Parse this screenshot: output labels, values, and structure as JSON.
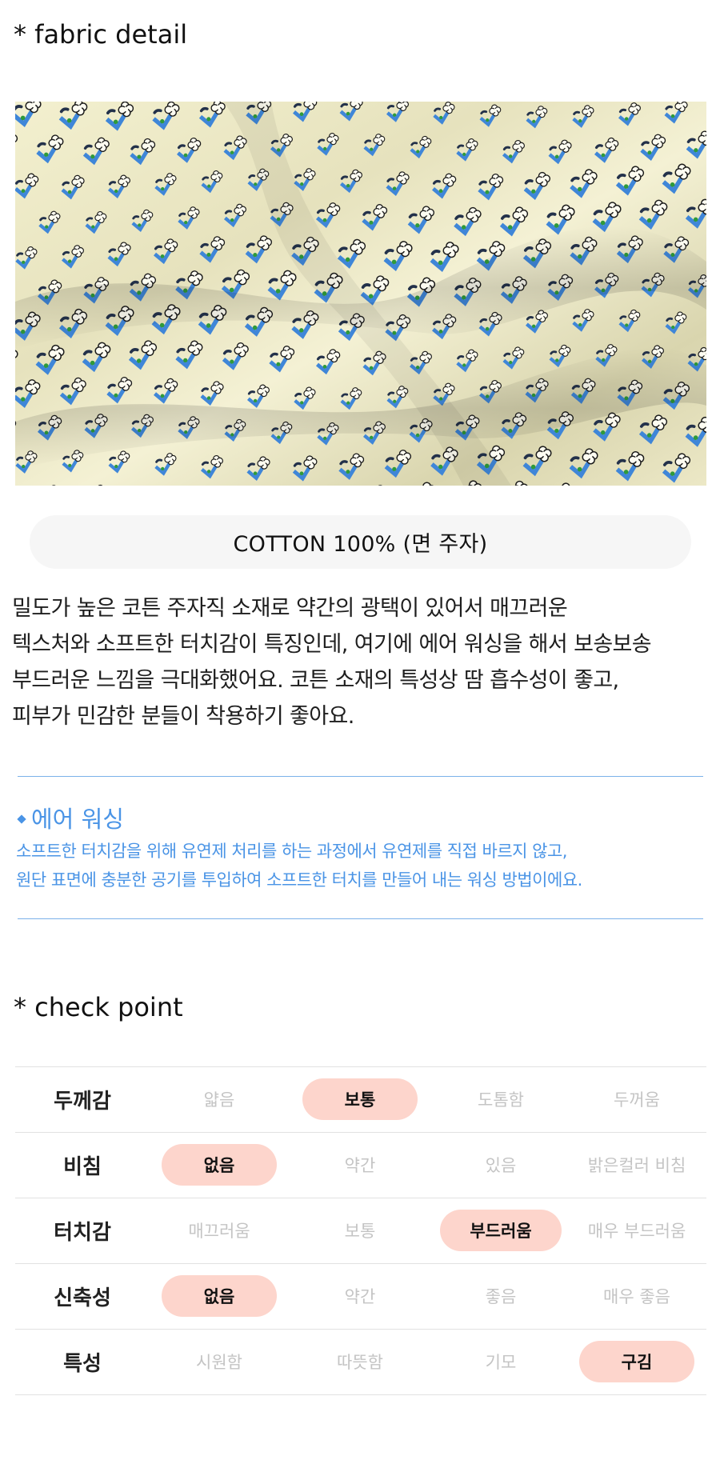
{
  "fabric_detail": {
    "title": "* fabric detail",
    "image_description_icon": "fabric-pattern-photo",
    "composition": "COTTON 100% (면 주자)",
    "description_lines": [
      "밀도가 높은 코튼 주자직 소재로 약간의 광택이 있어서 매끄러운",
      "텍스처와 소프트한 터치감이 특징인데, 여기에 에어 워싱을 해서 보송보송",
      "부드러운 느낌을 극대화했어요. 코튼 소재의 특성상 땀 흡수성이 좋고,",
      "피부가 민감한 분들이 착용하기 좋아요."
    ]
  },
  "air_wash": {
    "title": "에어 워싱",
    "lines": [
      "소프트한 터치감을 위해 유연제 처리를 하는 과정에서 유연제를 직접 바르지 않고,",
      "원단 표면에 충분한 공기를 투입하여 소프트한 터치를 만들어 내는 워싱 방법이에요."
    ],
    "accent_color": "#4a94e6"
  },
  "check_point": {
    "title": "* check point",
    "highlight_color": "#fdd5cc",
    "rows": [
      {
        "label": "두께감",
        "options": [
          "얇음",
          "보통",
          "도톰함",
          "두꺼움"
        ],
        "selected": 1
      },
      {
        "label": "비침",
        "options": [
          "없음",
          "약간",
          "있음",
          "밝은컬러 비침"
        ],
        "selected": 0
      },
      {
        "label": "터치감",
        "options": [
          "매끄러움",
          "보통",
          "부드러움",
          "매우 부드러움"
        ],
        "selected": 2
      },
      {
        "label": "신축성",
        "options": [
          "없음",
          "약간",
          "좋음",
          "매우 좋음"
        ],
        "selected": 0
      },
      {
        "label": "특성",
        "options": [
          "시원함",
          "따뜻함",
          "기모",
          "구김"
        ],
        "selected": 3
      }
    ]
  }
}
